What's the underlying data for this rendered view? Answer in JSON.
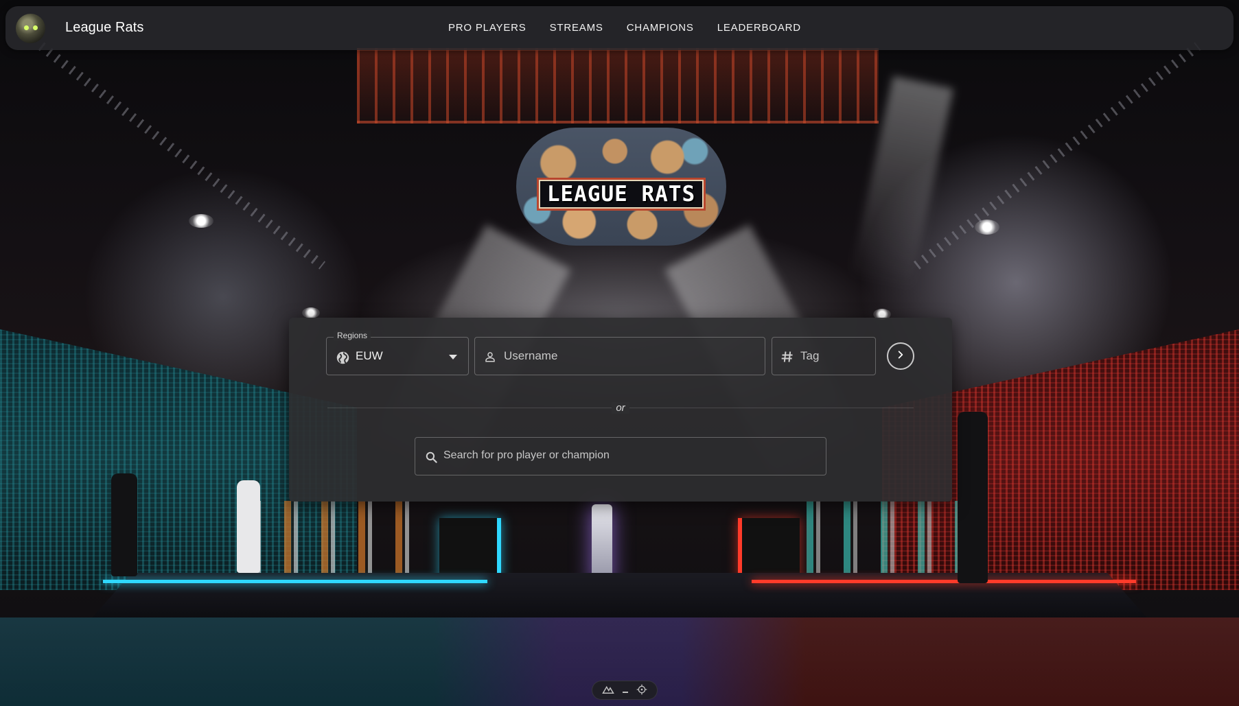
{
  "brand": {
    "title": "League Rats",
    "avatar_icon": "rat-avatar-icon"
  },
  "nav": {
    "links": [
      "PRO PLAYERS",
      "STREAMS",
      "CHAMPIONS",
      "LEADERBOARD"
    ]
  },
  "logo": {
    "text": "LEAGUE RATS"
  },
  "search": {
    "region_label": "Regions",
    "region_value": "EUW",
    "username_placeholder": "Username",
    "tag_placeholder": "Tag",
    "or_text": "or",
    "global_placeholder": "Search for pro player or champion"
  },
  "colors": {
    "panel": "#2e2e30",
    "navbar": "#28282c",
    "accent_blue": "#2fd8ff",
    "accent_red": "#ff3b2a"
  }
}
